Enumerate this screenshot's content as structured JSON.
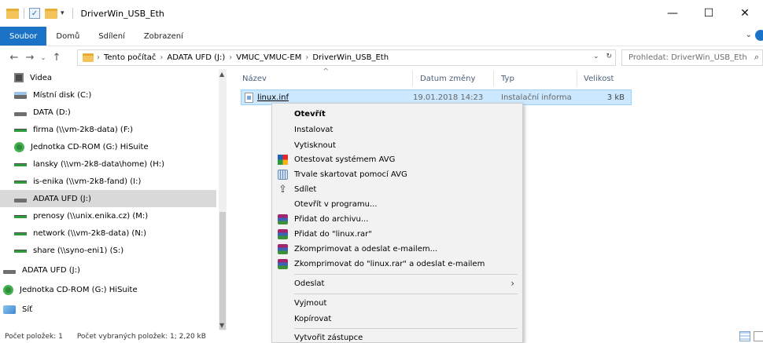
{
  "window": {
    "title": "DriverWin_USB_Eth",
    "min_glyph": "—",
    "max_glyph": "☐",
    "close_glyph": "✕"
  },
  "ribbon": {
    "tabs": [
      {
        "label": "Soubor",
        "active": true
      },
      {
        "label": "Domů"
      },
      {
        "label": "Sdílení"
      },
      {
        "label": "Zobrazení"
      }
    ],
    "expand_glyph": "⌄"
  },
  "address": {
    "nav_back": "←",
    "nav_forward": "→",
    "nav_recent": "⌄",
    "nav_up": "↑",
    "crumbs": [
      "Tento počítač",
      "ADATA UFD (J:)",
      "VMUC_VMUC-EM",
      "DriverWin_USB_Eth"
    ],
    "sep_glyph": "›",
    "tail_dropdown": "⌄",
    "tail_refresh": "↻",
    "search_placeholder": "Prohledat: DriverWin_USB_Eth",
    "search_glyph": "⌕"
  },
  "nav_pane": {
    "items": [
      {
        "label": "Videa",
        "icon": "video-icon"
      },
      {
        "label": "Místní disk (C:)",
        "icon": "os-disk-icon"
      },
      {
        "label": "DATA (D:)",
        "icon": "drive-icon"
      },
      {
        "label": "firma (\\\\vm-2k8-data) (F:)",
        "icon": "network-drive-icon"
      },
      {
        "label": "Jednotka CD-ROM (G:) HiSuite",
        "icon": "cdrom-icon"
      },
      {
        "label": "lansky (\\\\vm-2k8-data\\home) (H:)",
        "icon": "network-drive-icon"
      },
      {
        "label": "is-enika (\\\\vm-2k8-fand) (I:)",
        "icon": "network-drive-icon"
      },
      {
        "label": "ADATA UFD (J:)",
        "icon": "drive-icon",
        "selected": true
      },
      {
        "label": "prenosy (\\\\unix.enika.cz) (M:)",
        "icon": "network-drive-icon"
      },
      {
        "label": "network (\\\\vm-2k8-data) (N:)",
        "icon": "network-drive-icon"
      },
      {
        "label": "share (\\\\syno-eni1) (S:)",
        "icon": "network-drive-icon"
      },
      {
        "label": "ADATA UFD (J:)",
        "icon": "drive-icon"
      },
      {
        "label": "Jednotka CD-ROM (G:) HiSuite",
        "icon": "cdrom-icon"
      },
      {
        "label": "Síť",
        "icon": "network-icon"
      }
    ],
    "scroll_up": "▲",
    "scroll_down": "▼"
  },
  "file_list": {
    "columns": [
      "Název",
      "Datum změny",
      "Typ",
      "Velikost"
    ],
    "sort_glyph": "^",
    "files": [
      {
        "name": "linux.inf",
        "date": "19.01.2018 14:23",
        "type": "Instalační informa",
        "size": "3 kB"
      }
    ]
  },
  "context_menu": {
    "items": [
      {
        "label": "Otevřít",
        "bold": true
      },
      {
        "label": "Instalovat"
      },
      {
        "label": "Vytisknout"
      },
      {
        "label": "Otestovat systémem AVG",
        "icon": "avg-icon"
      },
      {
        "label": "Trvale skartovat pomocí AVG",
        "icon": "shredder-icon"
      },
      {
        "label": "Sdílet",
        "icon": "share-icon"
      },
      {
        "label": "Otevřít v programu..."
      },
      {
        "label": "Přidat do archivu...",
        "icon": "winrar-icon"
      },
      {
        "label": "Přidat do \"linux.rar\"",
        "icon": "winrar-icon"
      },
      {
        "label": "Zkomprimovat a odeslat e-mailem...",
        "icon": "winrar-icon"
      },
      {
        "label": "Zkomprimovat do \"linux.rar\" a odeslat e-mailem",
        "icon": "winrar-icon"
      },
      {
        "label": "Odeslat",
        "submenu": true
      },
      {
        "label": "Vyjmout"
      },
      {
        "label": "Kopírovat"
      },
      {
        "label": "Vytvořit zástupce"
      }
    ],
    "submenu_glyph": "›",
    "share_glyph": "⇪"
  },
  "status": {
    "item_count": "Počet položek: 1",
    "selected": "Počet vybraných položek: 1; 2,20 kB"
  }
}
